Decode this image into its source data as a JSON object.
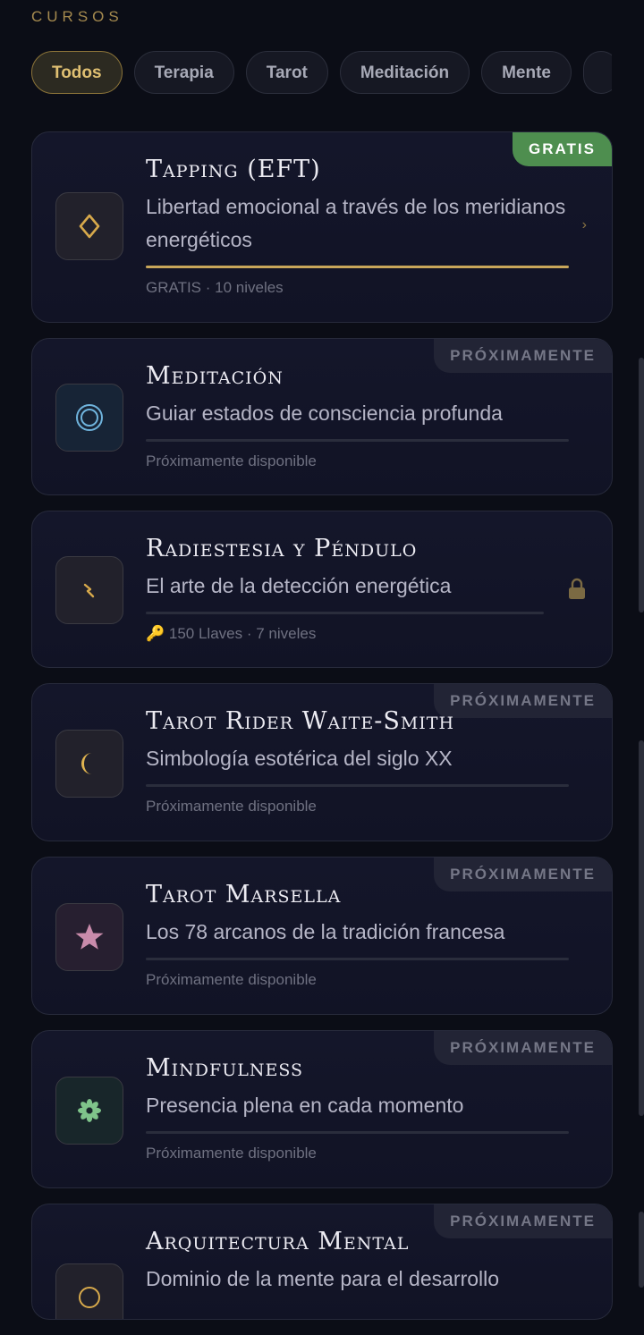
{
  "section_title": "CURSOS",
  "filters": [
    {
      "label": "Todos",
      "active": true
    },
    {
      "label": "Terapia",
      "active": false
    },
    {
      "label": "Tarot",
      "active": false
    },
    {
      "label": "Meditación",
      "active": false
    },
    {
      "label": "Mente",
      "active": false
    },
    {
      "label": "",
      "active": false
    }
  ],
  "courses": [
    {
      "title": "Tapping (EFT)",
      "subtitle": "Libertad emocional a través de los meridianos energéticos",
      "badge": "GRATIS",
      "badge_type": "free",
      "meta": "GRATIS · 10 niveles",
      "icon": "diamond-outline-icon",
      "icon_color": "#d7a94b",
      "icon_bg": "#22212b",
      "progress": 1.0,
      "trailing": "chevron"
    },
    {
      "title": "Meditación",
      "subtitle": "Guiar estados de consciencia profunda",
      "badge": "PRÓXIMAMENTE",
      "badge_type": "soon",
      "meta": "Próximamente disponible",
      "icon": "concentric-circles-icon",
      "icon_color": "#6fb3dc",
      "icon_bg": "#172436",
      "progress": 0,
      "trailing": "none"
    },
    {
      "title": "Radiestesia y Péndulo",
      "subtitle": "El arte de la detección energética",
      "badge": "",
      "badge_type": "none",
      "meta": "🔑 150 Llaves · 7 niveles",
      "icon": "lightning-icon",
      "icon_color": "#d7a94b",
      "icon_bg": "#22212b",
      "progress": 0,
      "trailing": "lock"
    },
    {
      "title": "Tarot Rider Waite-Smith",
      "subtitle": "Simbología esotérica del siglo XX",
      "badge": "PRÓXIMAMENTE",
      "badge_type": "soon",
      "meta": "Próximamente disponible",
      "icon": "crescent-moon-icon",
      "icon_color": "#e0b450",
      "icon_bg": "#22212b",
      "progress": 0,
      "trailing": "none"
    },
    {
      "title": "Tarot Marsella",
      "subtitle": "Los 78 arcanos de la tradición francesa",
      "badge": "PRÓXIMAMENTE",
      "badge_type": "soon",
      "meta": "Próximamente disponible",
      "icon": "star-icon",
      "icon_color": "#c98bab",
      "icon_bg": "#271f30",
      "progress": 0,
      "trailing": "none"
    },
    {
      "title": "Mindfulness",
      "subtitle": "Presencia plena en cada momento",
      "badge": "PRÓXIMAMENTE",
      "badge_type": "soon",
      "meta": "Próximamente disponible",
      "icon": "flower-asterisk-icon",
      "icon_color": "#7fc48a",
      "icon_bg": "#18262a",
      "progress": 0,
      "trailing": "none"
    },
    {
      "title": "Arquitectura Mental",
      "subtitle": "Dominio de la mente para el desarrollo",
      "badge": "PRÓXIMAMENTE",
      "badge_type": "soon",
      "meta": "",
      "icon": "brain-icon",
      "icon_color": "#d7a94b",
      "icon_bg": "#22212b",
      "progress": 0,
      "trailing": "none"
    }
  ]
}
